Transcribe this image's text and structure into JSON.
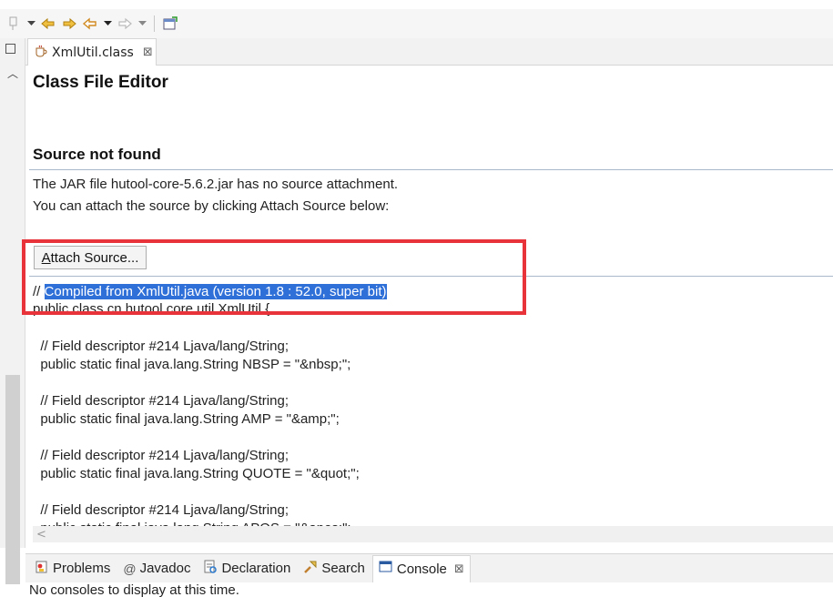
{
  "toolbar": {
    "icons": [
      "pin-icon",
      "dropdown-arrow",
      "prev-edit-icon",
      "next-edit-icon",
      "back-icon",
      "dropdown-arrow",
      "forward-icon",
      "dropdown-arrow",
      "open-perspective-icon"
    ]
  },
  "editor_tab": {
    "label": "XmlUtil.class",
    "close": "⊠"
  },
  "editor": {
    "title": "Class File Editor",
    "section_title": "Source not found",
    "desc_line1": "The JAR file hutool-core-5.6.2.jar has no source attachment.",
    "desc_line2": "You can attach the source by clicking Attach Source below:",
    "attach_button_mnemonic": "A",
    "attach_button_rest": "ttach Source..."
  },
  "code": {
    "line1_prefix": "// ",
    "line1_highlight": "Compiled from XmlUtil.java (version 1.8 : 52.0, super bit)",
    "line2": "public class cn.hutool.core.util.XmlUtil {",
    "blocks": [
      {
        "comment": "  // Field descriptor #214 Ljava/lang/String;",
        "decl": "  public static final java.lang.String NBSP = \"&nbsp;\";"
      },
      {
        "comment": "  // Field descriptor #214 Ljava/lang/String;",
        "decl": "  public static final java.lang.String AMP = \"&amp;\";"
      },
      {
        "comment": "  // Field descriptor #214 Ljava/lang/String;",
        "decl": "  public static final java.lang.String QUOTE = \"&quot;\";"
      },
      {
        "comment": "  // Field descriptor #214 Ljava/lang/String;",
        "decl": "  public static final java.lang.String APOS = \"&apos;\";"
      }
    ]
  },
  "hscroll": {
    "arrow": "<"
  },
  "bottom_tabs": [
    {
      "label": "Problems",
      "icon": "problems-icon"
    },
    {
      "label": "Javadoc",
      "icon": "javadoc-icon"
    },
    {
      "label": "Declaration",
      "icon": "declaration-icon"
    },
    {
      "label": "Search",
      "icon": "search-icon"
    },
    {
      "label": "Console",
      "icon": "console-icon",
      "close": "⊠"
    }
  ],
  "console_message": "No consoles to display at this time.",
  "colors": {
    "highlight": "#2f6fd8",
    "annotation_box": "#e8333a",
    "separator": "#aab8cc"
  }
}
